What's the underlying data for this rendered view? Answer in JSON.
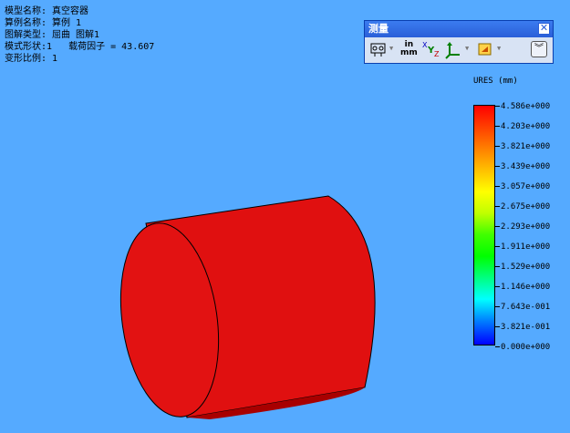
{
  "info": {
    "model": "模型名称: 真空容器",
    "study": "算例名称: 算例 1",
    "plot": "图解类型: 屈曲 图解1",
    "mode": "模式形状:1   载荷因子 = 43.607",
    "scale": "变形比例: 1"
  },
  "measure": {
    "title": "测量",
    "close_icon": "close-icon",
    "units_top": "in",
    "units_bottom": "mm",
    "xyz_label": "Y",
    "xyz_sub_x": "X",
    "xyz_sub_z": "Z"
  },
  "legend": {
    "title": "URES (mm)",
    "labels": [
      "4.586e+000",
      "4.203e+000",
      "3.821e+000",
      "3.439e+000",
      "3.057e+000",
      "2.675e+000",
      "2.293e+000",
      "1.911e+000",
      "1.529e+000",
      "1.146e+000",
      "7.643e-001",
      "3.821e-001",
      "0.000e+000"
    ]
  },
  "colors": {
    "background": "#55aaff",
    "cylinder": "#e01010",
    "cylinder_dark": "#b00000"
  }
}
